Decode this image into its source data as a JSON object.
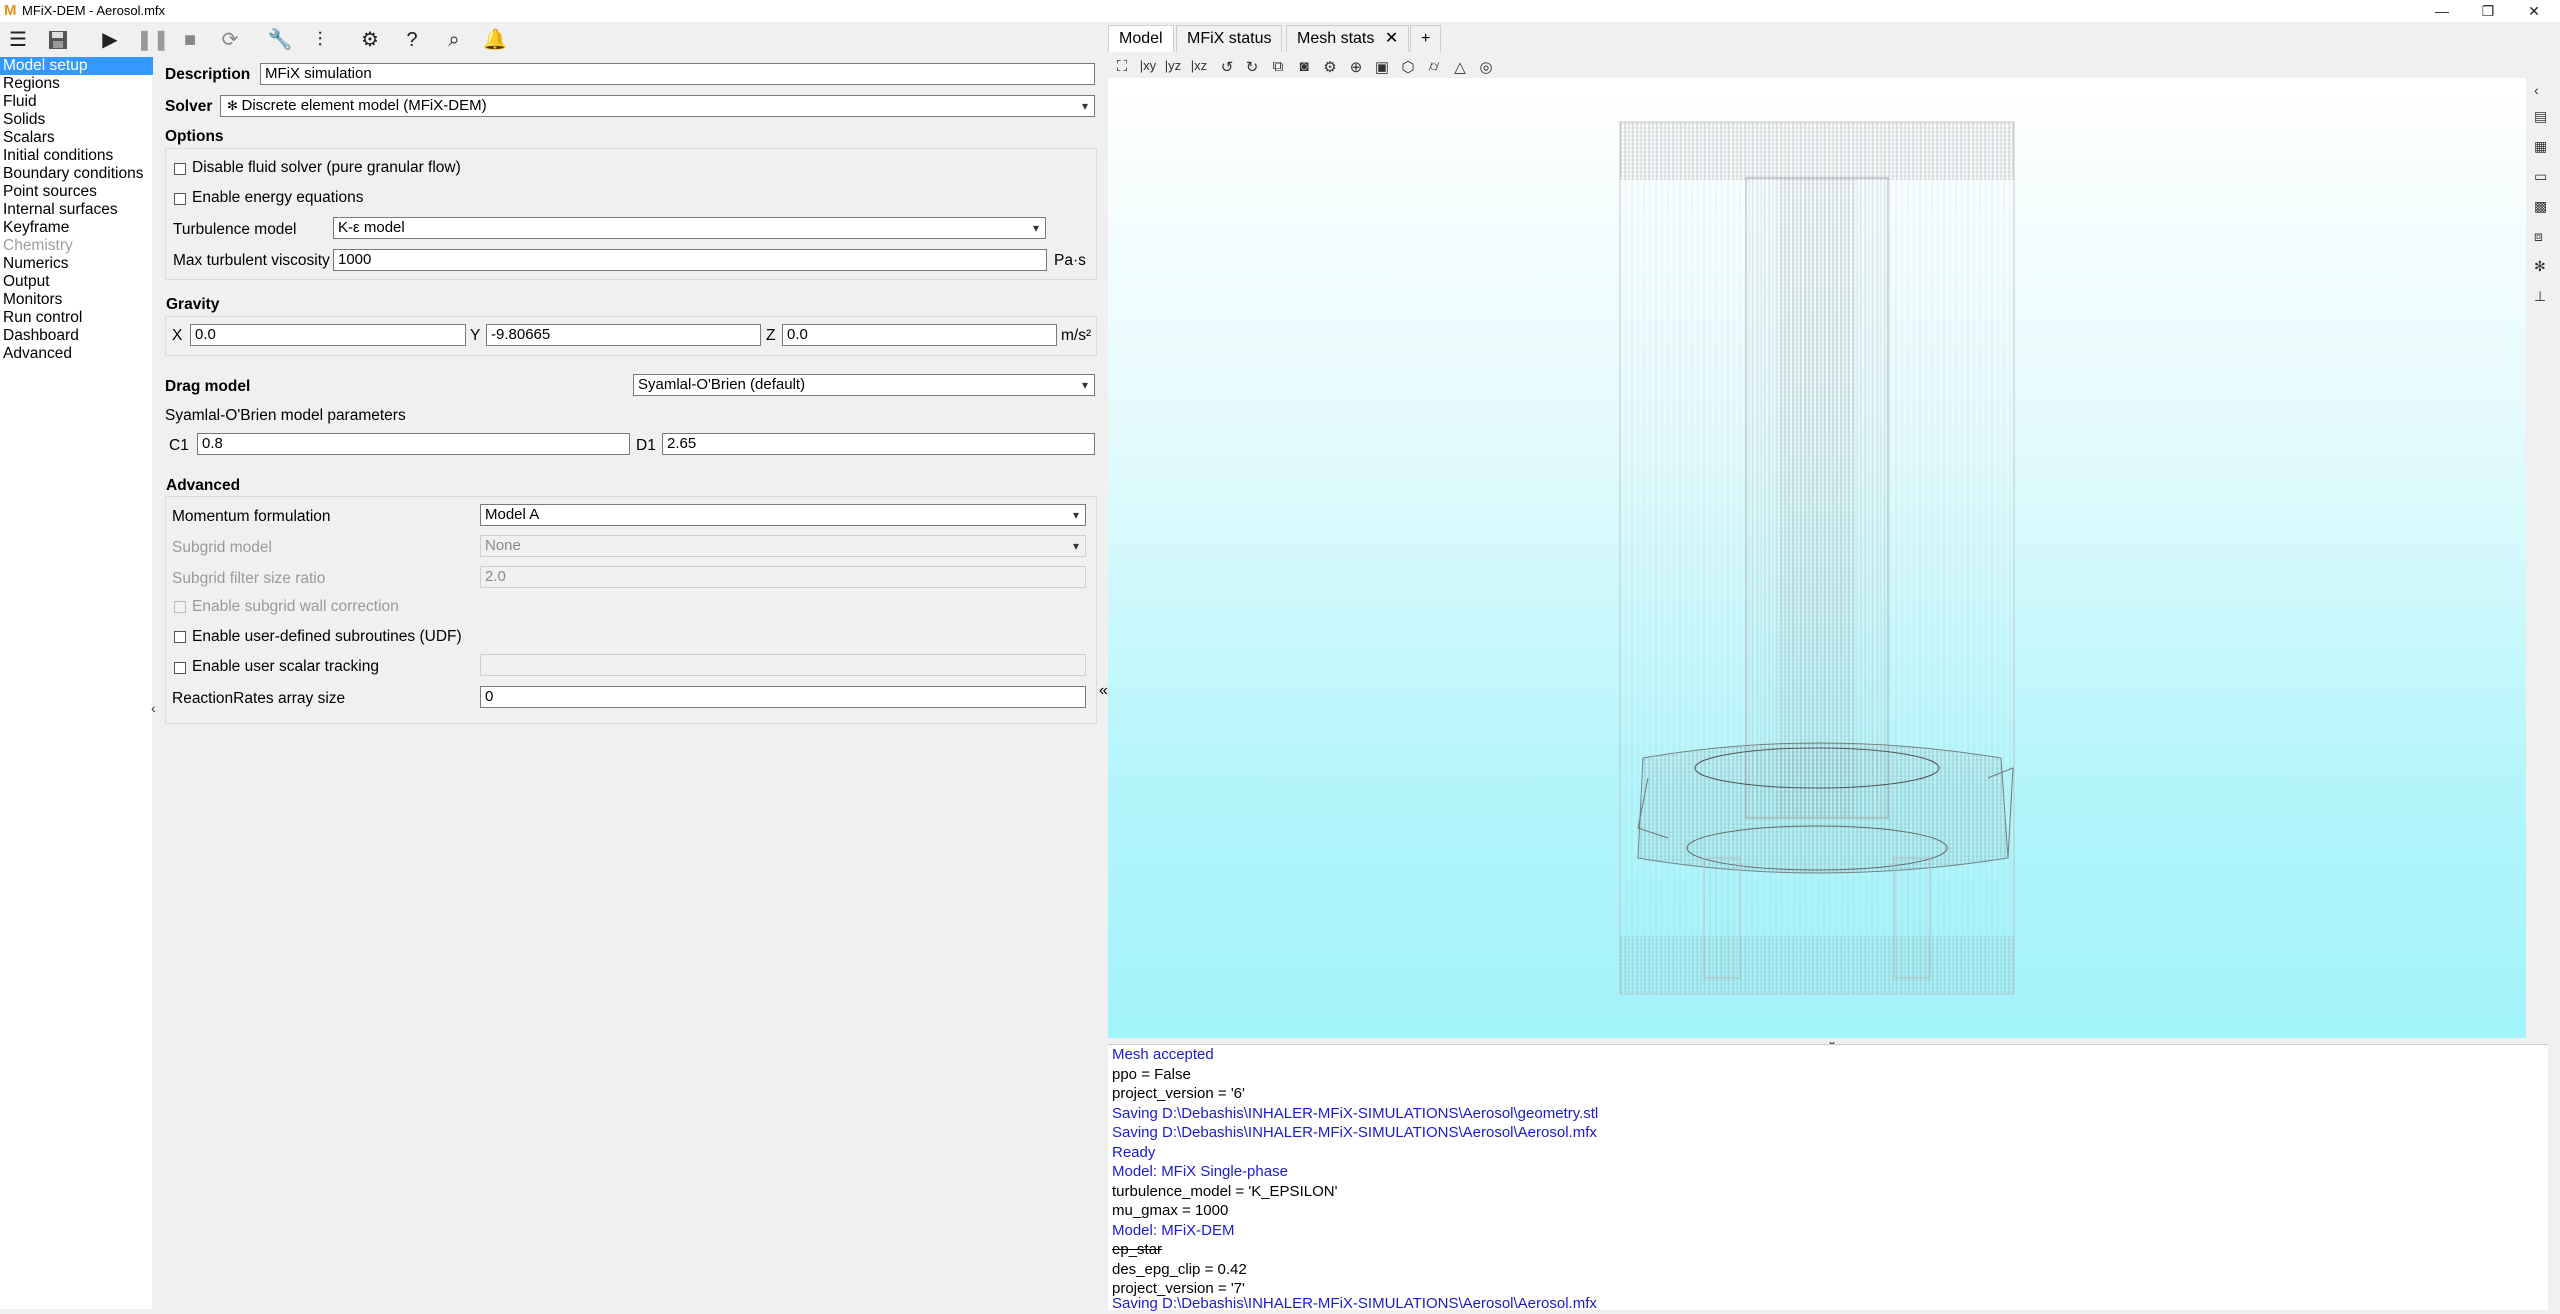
{
  "window": {
    "title": "MFiX-DEM - Aerosol.mfx",
    "app_icon": "M",
    "controls": [
      "—",
      "❐",
      "✕"
    ]
  },
  "toolbar": {
    "icons": [
      "menu-icon",
      "save-icon",
      "play-icon",
      "pause-icon",
      "stop-icon",
      "reset-icon",
      "wrench-icon",
      "sliders-icon",
      "gear-icon",
      "help-icon",
      "search-icon",
      "bell-icon"
    ]
  },
  "nav": {
    "items": [
      {
        "label": "Model setup",
        "selected": true
      },
      {
        "label": "Regions"
      },
      {
        "label": "Fluid"
      },
      {
        "label": "Solids"
      },
      {
        "label": "Scalars"
      },
      {
        "label": "Initial conditions"
      },
      {
        "label": "Boundary conditions"
      },
      {
        "label": "Point sources"
      },
      {
        "label": "Internal surfaces"
      },
      {
        "label": "Keyframe"
      },
      {
        "label": "Chemistry",
        "disabled": true
      },
      {
        "label": "Numerics"
      },
      {
        "label": "Output"
      },
      {
        "label": "Monitors"
      },
      {
        "label": "Run control"
      },
      {
        "label": "Dashboard"
      },
      {
        "label": "Advanced"
      }
    ]
  },
  "form": {
    "description_label": "Description",
    "description_value": "MFiX simulation",
    "solver_label": "Solver",
    "solver_value": "Discrete element model (MFiX-DEM)",
    "options_label": "Options",
    "disable_fluid_label": "Disable fluid solver (pure granular flow)",
    "enable_energy_label": "Enable energy equations",
    "turbulence_label": "Turbulence model",
    "turbulence_value": "K-ε model",
    "max_visc_label": "Max turbulent viscosity",
    "max_visc_value": "1000",
    "max_visc_unit": "Pa·s",
    "gravity_label": "Gravity",
    "gx_label": "X",
    "gx_value": "0.0",
    "gy_label": "Y",
    "gy_value": "-9.80665",
    "gz_label": "Z",
    "gz_value": "0.0",
    "gravity_unit": "m/s²",
    "drag_label": "Drag model",
    "drag_value": "Syamlal-O'Brien (default)",
    "drag_params_label": "Syamlal-O'Brien model parameters",
    "c1_label": "C1",
    "c1_value": "0.8",
    "d1_label": "D1",
    "d1_value": "2.65",
    "advanced_label": "Advanced",
    "momentum_label": "Momentum formulation",
    "momentum_value": "Model A",
    "subgrid_label": "Subgrid model",
    "subgrid_value": "None",
    "subgrid_ratio_label": "Subgrid filter size ratio",
    "subgrid_ratio_value": "2.0",
    "subgrid_wall_label": "Enable subgrid wall correction",
    "udf_label": "Enable user-defined subroutines (UDF)",
    "scalar_tracking_label": "Enable user scalar tracking",
    "scalar_tracking_value": "",
    "reaction_label": "ReactionRates array size",
    "reaction_value": "0"
  },
  "tabs": [
    {
      "label": "Model",
      "active": true
    },
    {
      "label": "MFiX status"
    },
    {
      "label": "Mesh stats",
      "closable": true
    },
    {
      "label": "+"
    }
  ],
  "view_toolbar": {
    "labels": [
      "|xy",
      "|yz",
      "|xz"
    ]
  },
  "console": {
    "lines": [
      {
        "text": "Mesh accepted",
        "kind": "info"
      },
      {
        "text": "ppo = False",
        "kind": "plain"
      },
      {
        "text": "project_version = '6'",
        "kind": "plain"
      },
      {
        "text": "Saving D:\\Debashis\\INHALER-MFiX-SIMULATIONS\\Aerosol\\geometry.stl",
        "kind": "info"
      },
      {
        "text": "Saving D:\\Debashis\\INHALER-MFiX-SIMULATIONS\\Aerosol\\Aerosol.mfx",
        "kind": "info"
      },
      {
        "text": "Ready",
        "kind": "info"
      },
      {
        "text": "Model: MFiX Single-phase",
        "kind": "info"
      },
      {
        "text": "turbulence_model = 'K_EPSILON'",
        "kind": "plain"
      },
      {
        "text": "mu_gmax = 1000",
        "kind": "plain"
      },
      {
        "text": "Model: MFiX-DEM",
        "kind": "info"
      },
      {
        "text": "ep_star",
        "kind": "strike"
      },
      {
        "text": "des_epg_clip = 0.42",
        "kind": "plain"
      },
      {
        "text": "project_version = '7'",
        "kind": "plain"
      },
      {
        "text": "Saving D:\\Debashis\\INHALER-MFiX-SIMULATIONS\\Aerosol\\Aerosol.mfx",
        "kind": "info"
      }
    ]
  }
}
